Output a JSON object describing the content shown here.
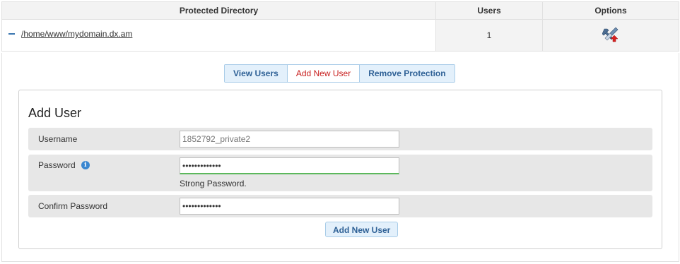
{
  "table": {
    "headers": {
      "directory": "Protected Directory",
      "users": "Users",
      "options": "Options"
    },
    "rows": [
      {
        "path": "/home/www/mydomain.dx.am",
        "users": "1",
        "option_icon": "tools-icon"
      }
    ]
  },
  "tabs": [
    {
      "label": "View Users",
      "active": false
    },
    {
      "label": "Add New User",
      "active": true
    },
    {
      "label": "Remove Protection",
      "active": false
    }
  ],
  "form": {
    "title": "Add User",
    "username": {
      "label": "Username",
      "value": "1852792_private2"
    },
    "password": {
      "label": "Password",
      "info_icon": "info-icon",
      "value": "•••••••••••••",
      "strength": "Strong Password.",
      "strength_color": "#5cb85c"
    },
    "confirm": {
      "label": "Confirm Password",
      "value": "•••••••••••••"
    },
    "submit_label": "Add New User"
  },
  "colors": {
    "accent": "#2f6196",
    "active_tab": "#c8201f",
    "tab_bg": "#e3f0fb",
    "row_bg": "#e7e7e7"
  }
}
